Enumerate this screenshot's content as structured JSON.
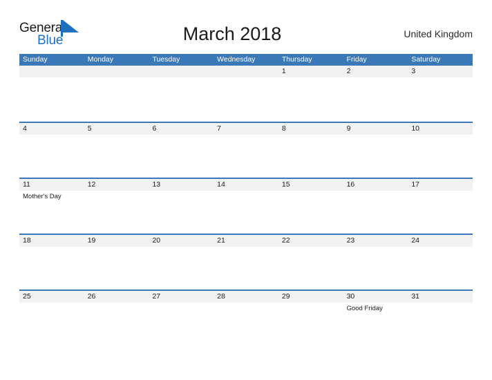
{
  "header": {
    "brand": {
      "word_one": "General",
      "word_two": "Blue",
      "flag_icon": "blue-flag-triangle",
      "blue_hex": "#1f6fbf"
    },
    "title": "March 2018",
    "country": "United Kingdom"
  },
  "colors": {
    "header_band": "#3b78b8",
    "day_strip": "#f2f2f2",
    "text": "#1a1a1a",
    "white": "#ffffff"
  },
  "weekdays": [
    "Sunday",
    "Monday",
    "Tuesday",
    "Wednesday",
    "Thursday",
    "Friday",
    "Saturday"
  ],
  "weeks": [
    {
      "days": [
        {
          "number": "",
          "events": []
        },
        {
          "number": "",
          "events": []
        },
        {
          "number": "",
          "events": []
        },
        {
          "number": "",
          "events": []
        },
        {
          "number": "1",
          "events": []
        },
        {
          "number": "2",
          "events": []
        },
        {
          "number": "3",
          "events": []
        }
      ]
    },
    {
      "days": [
        {
          "number": "4",
          "events": []
        },
        {
          "number": "5",
          "events": []
        },
        {
          "number": "6",
          "events": []
        },
        {
          "number": "7",
          "events": []
        },
        {
          "number": "8",
          "events": []
        },
        {
          "number": "9",
          "events": []
        },
        {
          "number": "10",
          "events": []
        }
      ]
    },
    {
      "days": [
        {
          "number": "11",
          "events": [
            "Mother's Day"
          ]
        },
        {
          "number": "12",
          "events": []
        },
        {
          "number": "13",
          "events": []
        },
        {
          "number": "14",
          "events": []
        },
        {
          "number": "15",
          "events": []
        },
        {
          "number": "16",
          "events": []
        },
        {
          "number": "17",
          "events": []
        }
      ]
    },
    {
      "days": [
        {
          "number": "18",
          "events": []
        },
        {
          "number": "19",
          "events": []
        },
        {
          "number": "20",
          "events": []
        },
        {
          "number": "21",
          "events": []
        },
        {
          "number": "22",
          "events": []
        },
        {
          "number": "23",
          "events": []
        },
        {
          "number": "24",
          "events": []
        }
      ]
    },
    {
      "days": [
        {
          "number": "25",
          "events": []
        },
        {
          "number": "26",
          "events": []
        },
        {
          "number": "27",
          "events": []
        },
        {
          "number": "28",
          "events": []
        },
        {
          "number": "29",
          "events": []
        },
        {
          "number": "30",
          "events": [
            "Good Friday"
          ]
        },
        {
          "number": "31",
          "events": []
        }
      ]
    }
  ]
}
